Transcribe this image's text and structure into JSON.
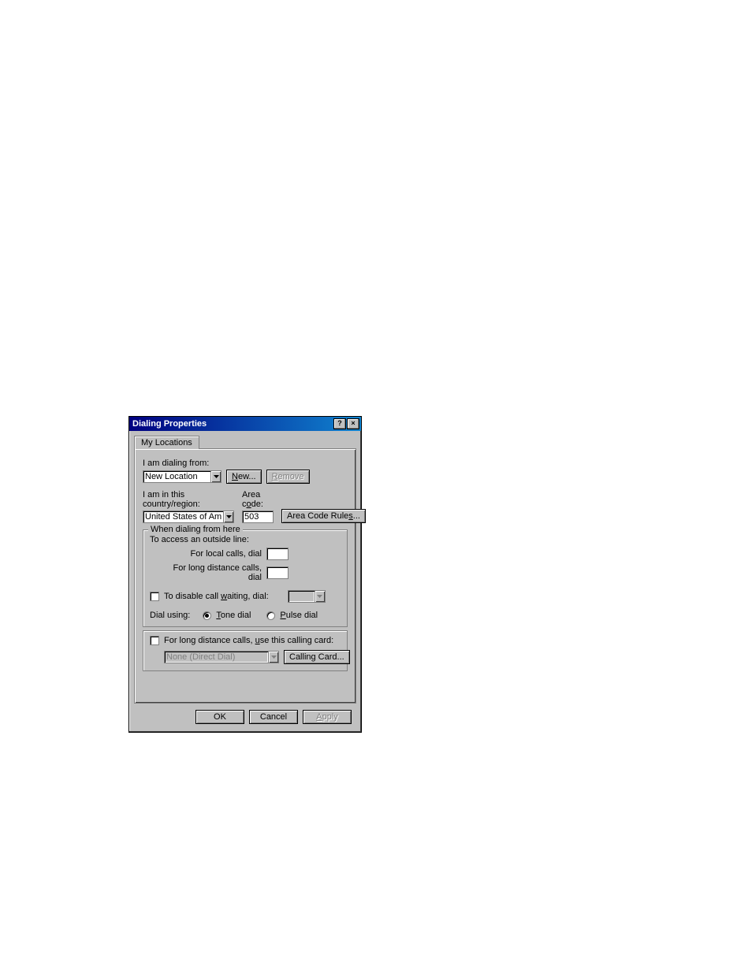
{
  "titlebar": {
    "title": "Dialing Properties",
    "help_glyph": "?",
    "close_glyph": "×"
  },
  "tab": {
    "label": "My Locations"
  },
  "dialing_from": {
    "label": "I am dialing from:",
    "value": "New Location",
    "new_button_prefix": "N",
    "new_button_rest": "ew...",
    "remove_button_prefix": "R",
    "remove_button_rest": "emove"
  },
  "country": {
    "label": "I am in this country/region:",
    "value": "United States of America",
    "area_code_label_prefix": "Area c",
    "area_code_label_underline": "o",
    "area_code_label_rest": "de:",
    "area_code_value": "503",
    "rules_button_prefix": "Area Code Rule",
    "rules_button_underline": "s",
    "rules_button_rest": "..."
  },
  "when_dialing": {
    "legend": "When dialing from here",
    "outside_line_label": "To access an outside line:",
    "local_label": "For local calls, dial",
    "local_value": "",
    "long_distance_label": "For long distance calls, dial",
    "long_distance_value": "",
    "call_waiting_prefix": "To disable call ",
    "call_waiting_underline": "w",
    "call_waiting_rest": "aiting, dial:",
    "call_waiting_value": "",
    "dial_using_label": "Dial using:",
    "tone_underline": "T",
    "tone_rest": "one dial",
    "pulse_underline": "P",
    "pulse_rest": "ulse dial"
  },
  "calling_card": {
    "checkbox_prefix": "For long distance calls, ",
    "checkbox_underline": "u",
    "checkbox_rest": "se this calling card:",
    "value": "None (Direct Dial)",
    "button": "Calling Card..."
  },
  "dialog_buttons": {
    "ok": "OK",
    "cancel": "Cancel",
    "apply_prefix": "A",
    "apply_rest": "pply"
  }
}
